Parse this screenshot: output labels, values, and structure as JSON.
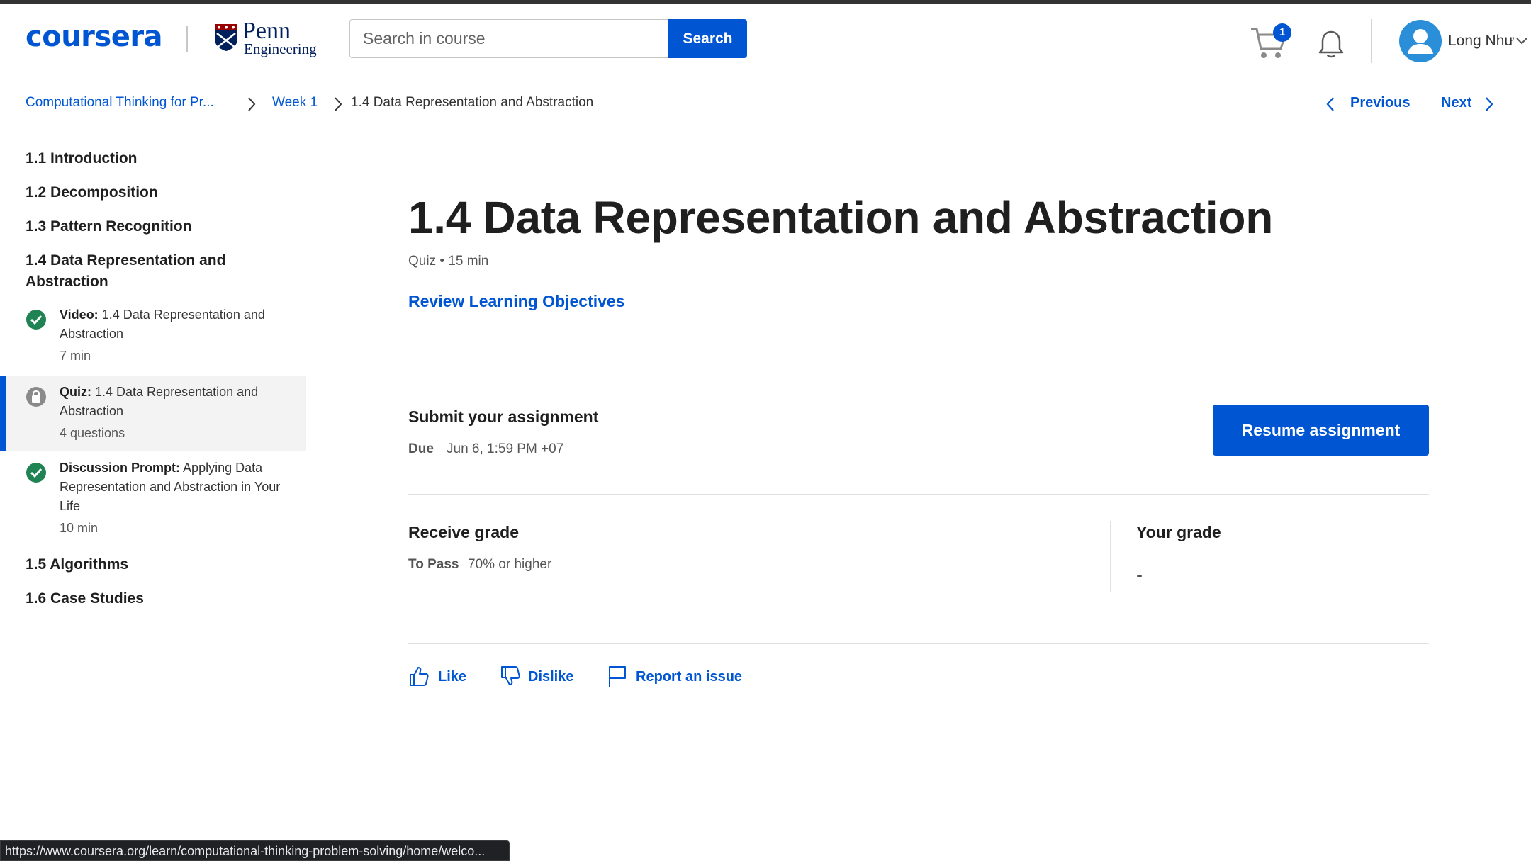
{
  "header": {
    "brand": "coursera",
    "partner": {
      "name": "Penn",
      "sub": "Engineering"
    },
    "search": {
      "placeholder": "Search in course",
      "value": "",
      "button_label": "Search"
    },
    "cart_count": "1",
    "user_name": "Long Như"
  },
  "breadcrumb": [
    {
      "label": "Computational Thinking for Pr..."
    },
    {
      "label": "Week 1"
    },
    {
      "label": "1.4 Data Representation and Abstraction"
    }
  ],
  "nav": {
    "previous": "Previous",
    "next": "Next"
  },
  "sidebar": {
    "sections": [
      {
        "label": "1.1 Introduction"
      },
      {
        "label": "1.2 Decomposition"
      },
      {
        "label": "1.3 Pattern Recognition"
      },
      {
        "label": "1.4 Data Representation and Abstraction"
      },
      {
        "label": "1.5 Algorithms"
      },
      {
        "label": "1.6 Case Studies"
      }
    ],
    "items": [
      {
        "type": "Video:",
        "title": "1.4 Data Representation and Abstraction",
        "meta": "7 min",
        "status": "completed"
      },
      {
        "type": "Quiz:",
        "title": "1.4 Data Representation and Abstraction",
        "meta": "4 questions",
        "status": "locked",
        "active": true
      },
      {
        "type": "Discussion Prompt:",
        "title": "Applying Data Representation and Abstraction in Your Life",
        "meta": "10 min",
        "status": "completed"
      }
    ]
  },
  "main": {
    "title": "1.4 Data Representation and Abstraction",
    "subtitle": "Quiz • 15 min",
    "review_link": "Review Learning Objectives",
    "submit": {
      "heading": "Submit your assignment",
      "due_label": "Due",
      "due_value": "Jun 6, 1:59 PM +07",
      "button": "Resume assignment"
    },
    "grade": {
      "receive_heading": "Receive grade",
      "to_pass_label": "To Pass",
      "to_pass_value": "70% or higher",
      "your_grade_heading": "Your grade",
      "your_grade_value": "-"
    },
    "actions": {
      "like": "Like",
      "dislike": "Dislike",
      "report": "Report an issue"
    }
  },
  "status_url": "https://www.coursera.org/learn/computational-thinking-problem-solving/home/welco...",
  "colors": {
    "brand": "#0056d2",
    "success": "#1f8354",
    "locked": "#8a8a8a"
  },
  "icons": [
    "cart-icon",
    "bell-icon",
    "user-avatar-icon",
    "chevron-right-icon",
    "chevron-left-icon",
    "check-circle-icon",
    "lock-icon",
    "thumbs-up-icon",
    "thumbs-down-icon",
    "flag-icon"
  ]
}
